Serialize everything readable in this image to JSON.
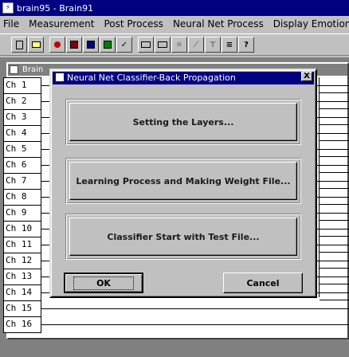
{
  "app": {
    "title": "brain95 - Brain91"
  },
  "menu": [
    {
      "label": "File"
    },
    {
      "label": "Measurement"
    },
    {
      "label": "Post Process"
    },
    {
      "label": "Neural Net Process"
    },
    {
      "label": "Display Emotion"
    }
  ],
  "toolbar": {
    "icons": [
      "new-file-icon",
      "open-file-icon",
      "record-icon",
      "stop-icon",
      "scope-icon",
      "chart-icon",
      "check-icon",
      "signal-icon",
      "signal2-icon",
      "zoom-icon",
      "graph-icon",
      "text-icon",
      "align-icon",
      "help-icon"
    ],
    "help_label": "?"
  },
  "child_window": {
    "title": "Brain"
  },
  "channels": [
    "Ch 1",
    "Ch 2",
    "Ch 3",
    "Ch 4",
    "Ch 5",
    "Ch 6",
    "Ch 7",
    "Ch 8",
    "Ch 9",
    "Ch 10",
    "Ch 11",
    "Ch 12",
    "Ch 13",
    "Ch 14",
    "Ch 15",
    "Ch 16"
  ],
  "dialog": {
    "title": "Neural Net Classifier-Back Propagation",
    "close_label": "X",
    "buttons": {
      "setting_layers": "Setting the Layers...",
      "learning": "Learning Process and Making Weight File...",
      "classifier": "Classifier Start with Test File...",
      "ok": "OK",
      "cancel": "Cancel"
    }
  }
}
